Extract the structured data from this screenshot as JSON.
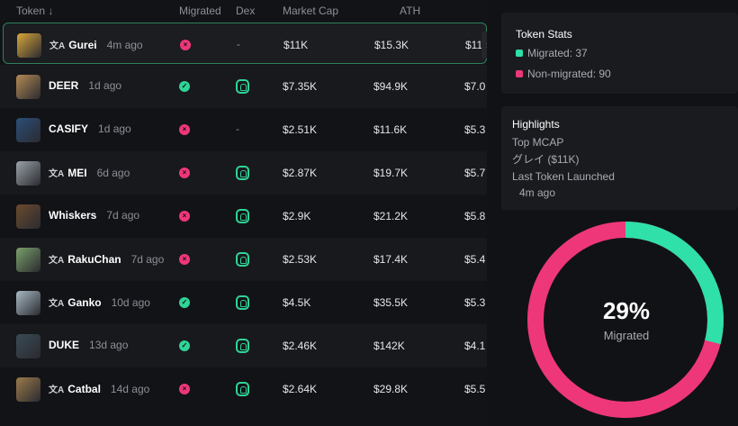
{
  "table": {
    "headers": {
      "token": "Token ↓",
      "migrated": "Migrated",
      "dex": "Dex",
      "market_cap": "Market Cap",
      "ath": "ATH"
    },
    "rows": [
      {
        "name": "Gurei",
        "age": "4m ago",
        "translated": true,
        "migrated": false,
        "dex": false,
        "mcap": "$11K",
        "ath": "$15.3K",
        "extra": "$11.",
        "avatar_color": "#d9a63a"
      },
      {
        "name": "DEER",
        "age": "1d ago",
        "translated": false,
        "migrated": true,
        "dex": true,
        "mcap": "$7.35K",
        "ath": "$94.9K",
        "extra": "$7.0",
        "avatar_color": "#b58a55"
      },
      {
        "name": "CASIFY",
        "age": "1d ago",
        "translated": false,
        "migrated": false,
        "dex": false,
        "mcap": "$2.51K",
        "ath": "$11.6K",
        "extra": "$5.3",
        "avatar_color": "#2b4e78"
      },
      {
        "name": "MEI",
        "age": "6d ago",
        "translated": true,
        "migrated": false,
        "dex": true,
        "mcap": "$2.87K",
        "ath": "$19.7K",
        "extra": "$5.7",
        "avatar_color": "#9aa3a8"
      },
      {
        "name": "Whiskers",
        "age": "7d ago",
        "translated": false,
        "migrated": false,
        "dex": true,
        "mcap": "$2.9K",
        "ath": "$21.2K",
        "extra": "$5.8",
        "avatar_color": "#6b4a2e"
      },
      {
        "name": "RakuChan",
        "age": "7d ago",
        "translated": true,
        "migrated": false,
        "dex": true,
        "mcap": "$2.53K",
        "ath": "$17.4K",
        "extra": "$5.4",
        "avatar_color": "#7aa06a"
      },
      {
        "name": "Ganko",
        "age": "10d ago",
        "translated": true,
        "migrated": true,
        "dex": true,
        "mcap": "$4.5K",
        "ath": "$35.5K",
        "extra": "$5.3",
        "avatar_color": "#a8b9c4"
      },
      {
        "name": "DUKE",
        "age": "13d ago",
        "translated": false,
        "migrated": true,
        "dex": true,
        "mcap": "$2.46K",
        "ath": "$142K",
        "extra": "$4.1",
        "avatar_color": "#3a4a55"
      },
      {
        "name": "Catbal",
        "age": "14d ago",
        "translated": true,
        "migrated": false,
        "dex": true,
        "mcap": "$2.64K",
        "ath": "$29.8K",
        "extra": "$5.5",
        "avatar_color": "#9c7a4a"
      }
    ]
  },
  "token_stats": {
    "title": "Token Stats",
    "migrated_label": "Migrated: 37",
    "non_migrated_label": "Non-migrated: 90",
    "migrated_count": 37,
    "non_migrated_count": 90,
    "migrated_color": "#2fe0a8",
    "non_migrated_color": "#ee3779"
  },
  "highlights": {
    "title": "Highlights",
    "top_mcap_label": "Top MCAP",
    "top_mcap_value": "グレイ ($11K)",
    "last_launched_label": "Last Token Launched",
    "last_launched_value": "4m ago"
  },
  "donut": {
    "percent_text": "29%",
    "label": "Migrated",
    "fraction": 0.29
  }
}
